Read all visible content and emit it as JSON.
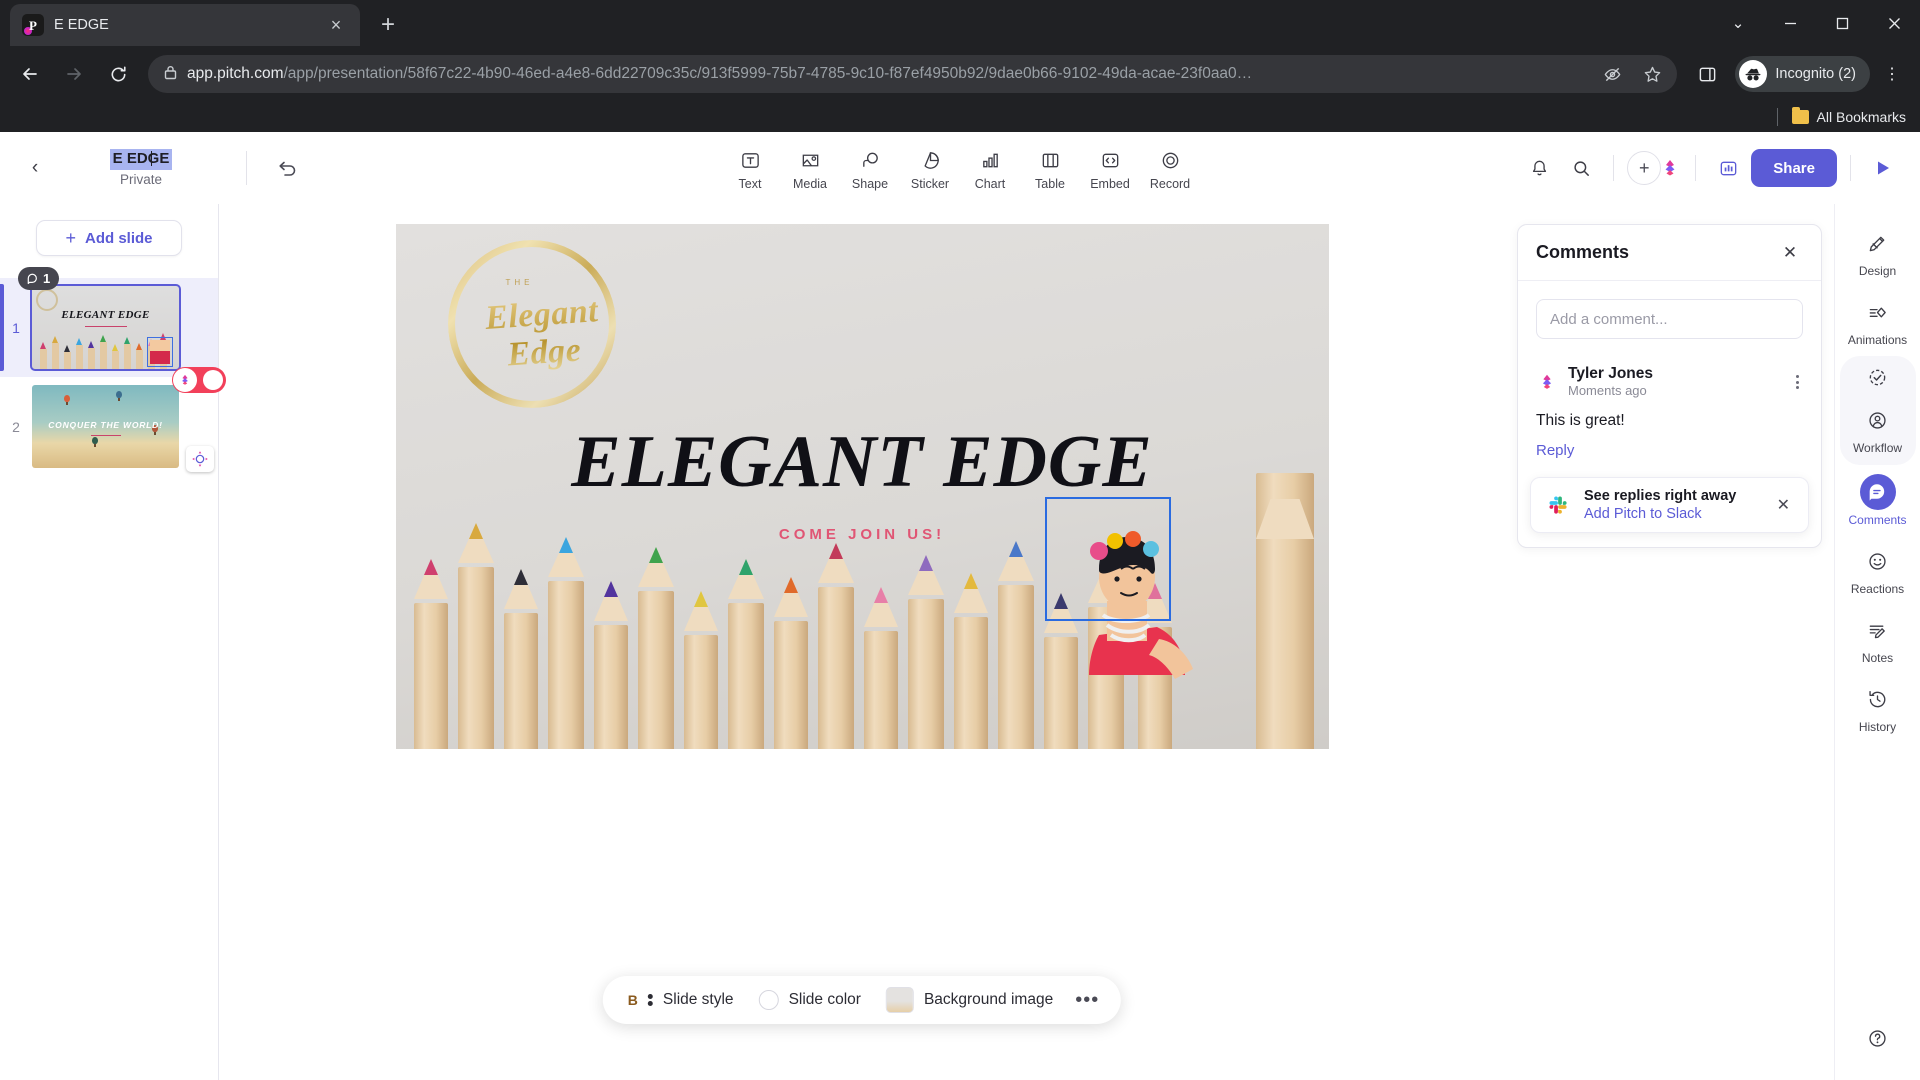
{
  "browser": {
    "tab": {
      "title": "E EDGE",
      "favicon": "pitch-logo-icon",
      "close": "×"
    },
    "new_tab": "+",
    "window_controls": {
      "minimize": "—",
      "maximize": "☐",
      "close": "✕",
      "chevron": "⌄"
    },
    "nav": {
      "back": "←",
      "forward": "→",
      "reload": "⟳"
    },
    "omnibox": {
      "lock": "lock-icon",
      "host": "app.pitch.com",
      "path": "/app/presentation/58f67c22-4b90-46ed-a4e8-6dd22709c35c/913f5999-75b7-4785-9c10-f87ef4950b92/9dae0b66-9102-49da-acae-23f0aa0…",
      "tracking_protection": "eye-off-icon",
      "bookmark": "star-icon"
    },
    "profile": {
      "label": "Incognito (2)",
      "avatar": "incognito-icon"
    },
    "menu": "⋮",
    "bookmarks_bar": {
      "label": "All Bookmarks"
    }
  },
  "app": {
    "header": {
      "back": "‹",
      "deck_title": "E EDGE",
      "privacy": "Private",
      "undo": "undo-icon",
      "tools": [
        {
          "label": "Text",
          "icon": "text-icon"
        },
        {
          "label": "Media",
          "icon": "media-icon"
        },
        {
          "label": "Shape",
          "icon": "shape-icon"
        },
        {
          "label": "Sticker",
          "icon": "sticker-icon"
        },
        {
          "label": "Chart",
          "icon": "chart-icon"
        },
        {
          "label": "Table",
          "icon": "table-icon"
        },
        {
          "label": "Embed",
          "icon": "embed-icon"
        },
        {
          "label": "Record",
          "icon": "record-icon"
        }
      ],
      "notifications": "bell-icon",
      "search": "search-icon",
      "add_collaborator": "+",
      "analytics": "analytics-icon",
      "share_label": "Share",
      "present": "play-icon",
      "accent": "#5b5bd6"
    },
    "slides_panel": {
      "add_slide_label": "Add slide",
      "add_slide_plus": "+",
      "slides": [
        {
          "number": "1",
          "title": "ELEGANT EDGE",
          "comment_count": "1",
          "active": true
        },
        {
          "number": "2",
          "title": "CONQUER THE WORLD!",
          "active": false
        }
      ]
    },
    "canvas": {
      "logo_script": "Elegant Edge",
      "logo_small": "THE",
      "title": "ELEGANT EDGE",
      "subtitle": "COME JOIN US!",
      "subtitle_color": "#e05574"
    },
    "style_bar": {
      "slide_style": "Slide style",
      "slide_color": "Slide color",
      "background_image": "Background image",
      "more": "•••",
      "bold_glyph": "B"
    },
    "comments": {
      "title": "Comments",
      "close": "✕",
      "input_placeholder": "Add a comment...",
      "input_value": "",
      "items": [
        {
          "author": "Tyler Jones",
          "time": "Moments ago",
          "text": "This is great!",
          "reply": "Reply"
        }
      ]
    },
    "slack_promo": {
      "headline": "See replies right away",
      "link": "Add Pitch to Slack",
      "close": "✕"
    },
    "right_rail": [
      {
        "label": "Design",
        "icon": "design-icon",
        "active": false
      },
      {
        "label": "Animations",
        "icon": "animations-icon",
        "active": false
      },
      {
        "label": "Workflow",
        "icon": "workflow-icon",
        "active": false
      },
      {
        "label": "Comments",
        "icon": "comments-icon",
        "active": true
      },
      {
        "label": "Reactions",
        "icon": "reactions-icon",
        "active": false
      },
      {
        "label": "Notes",
        "icon": "notes-icon",
        "active": false
      },
      {
        "label": "History",
        "icon": "history-icon",
        "active": false
      },
      {
        "label": "",
        "icon": "help-icon",
        "active": false
      }
    ]
  }
}
